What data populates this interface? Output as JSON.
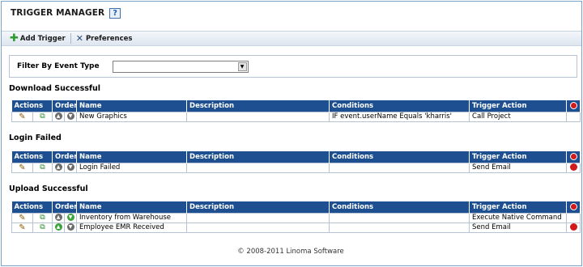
{
  "header": {
    "title": "TRIGGER MANAGER",
    "help_label": "?"
  },
  "toolbar": {
    "add_label": "Add Trigger",
    "prefs_label": "Preferences",
    "add_icon": "plus-icon",
    "prefs_icon": "tools-icon"
  },
  "filter": {
    "label": "Filter By Event Type",
    "value": ""
  },
  "columns": {
    "actions": "Actions",
    "order": "Order",
    "name": "Name",
    "description": "Description",
    "conditions": "Conditions",
    "trigger_action": "Trigger Action"
  },
  "sections": [
    {
      "title": "Download Successful",
      "rows": [
        {
          "name": "New Graphics",
          "description": "",
          "conditions": "IF event.userName Equals 'kharris'",
          "trigger_action": "Call Project",
          "up_enabled": false,
          "down_enabled": false,
          "stop_icon": false
        }
      ]
    },
    {
      "title": "Login Failed",
      "rows": [
        {
          "name": "Login Failed",
          "description": "",
          "conditions": "",
          "trigger_action": "Send Email",
          "up_enabled": false,
          "down_enabled": false,
          "stop_icon": true
        }
      ]
    },
    {
      "title": "Upload Successful",
      "rows": [
        {
          "name": "Inventory from Warehouse",
          "description": "",
          "conditions": "",
          "trigger_action": "Execute Native Command",
          "up_enabled": false,
          "down_enabled": true,
          "stop_icon": false
        },
        {
          "name": "Employee EMR Received",
          "description": "",
          "conditions": "",
          "trigger_action": "Send Email",
          "up_enabled": true,
          "down_enabled": false,
          "stop_icon": true
        }
      ]
    }
  ],
  "footer": {
    "text": "© 2008-2011 Linoma Software"
  },
  "colors": {
    "header_bg": "#1d4f91",
    "toolbar_bg": "#dde5ef",
    "stop": "#d11a1a",
    "enabled_arrow": "#3aa33a"
  }
}
